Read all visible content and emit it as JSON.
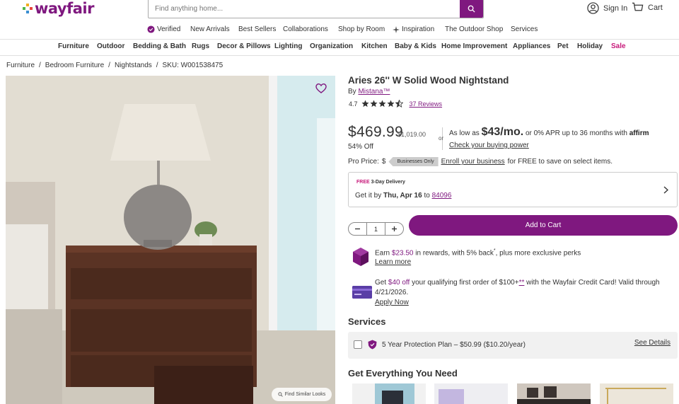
{
  "header": {
    "logo_text": "wayfair",
    "search_placeholder": "Find anything home...",
    "sign_in": "Sign In",
    "cart": "Cart"
  },
  "subnav": {
    "items": [
      "Verified",
      "New Arrivals",
      "Best Sellers",
      "Collaborations",
      "Shop by Room",
      "Inspiration",
      "The Outdoor Shop",
      "Services"
    ]
  },
  "catnav": {
    "items": [
      "Furniture",
      "Outdoor",
      "Bedding & Bath",
      "Rugs",
      "Decor & Pillows",
      "Lighting",
      "Organization",
      "Kitchen",
      "Baby & Kids",
      "Home Improvement",
      "Appliances",
      "Pet",
      "Holiday",
      "Sale"
    ]
  },
  "breadcrumb": {
    "items": [
      "Furniture",
      "Bedroom Furniture",
      "Nightstands",
      "SKU: W001538475"
    ],
    "separator": "/"
  },
  "product": {
    "title": "Aries 26'' W Solid Wood Nightstand",
    "by": "By",
    "brand": "Mistana™",
    "rating": "4.7",
    "stars": 4.5,
    "reviews": "37 Reviews",
    "price": "$469.99",
    "was_price": "$1,019.00",
    "percent_off": "54% Off",
    "or": "or",
    "affirm_prefix": "As low as",
    "affirm_amount": "$43/mo.",
    "affirm_suffix": "or 0% APR up to 36 months with",
    "affirm_logo": "affirm",
    "check_power": "Check your buying power",
    "pro_label": "Pro Price:",
    "pro_value": "$",
    "biz_badge": "Businesses Only",
    "enroll_link": "Enroll your business",
    "enroll_suffix": "for FREE to save on select items.",
    "similar_looks": "Find Similar Looks"
  },
  "delivery": {
    "badge_prefix": "FREE",
    "badge_suffix": "3-Day Delivery",
    "get_it_prefix": "Get it by",
    "date": "Thu, Apr 16",
    "to": "to",
    "zip": "84096"
  },
  "cart": {
    "quantity": "1",
    "add_label": "Add to Cart"
  },
  "rewards": {
    "earn": "Earn",
    "amount": "$23.50",
    "suffix": "in rewards, with 5% back",
    "sup": "*",
    "plus": ", plus more exclusive perks",
    "learn_more": "Learn more"
  },
  "credit": {
    "get": "Get",
    "amount": "$40 off",
    "mid": "your qualifying first order of $100+",
    "asterisk": "**",
    "rest": "with the Wayfair Credit Card! Valid through 4/21/2026.",
    "apply": "Apply Now"
  },
  "services": {
    "heading": "Services",
    "plan": "5 Year Protection Plan – $50.99",
    "plan_yearly": "($10.20/year)",
    "see_details": "See Details"
  },
  "everything": {
    "heading": "Get Everything You Need"
  },
  "colors": {
    "brand": "#7f187f",
    "sale": "#c7197a",
    "credit_card": "#5a3ea6"
  }
}
